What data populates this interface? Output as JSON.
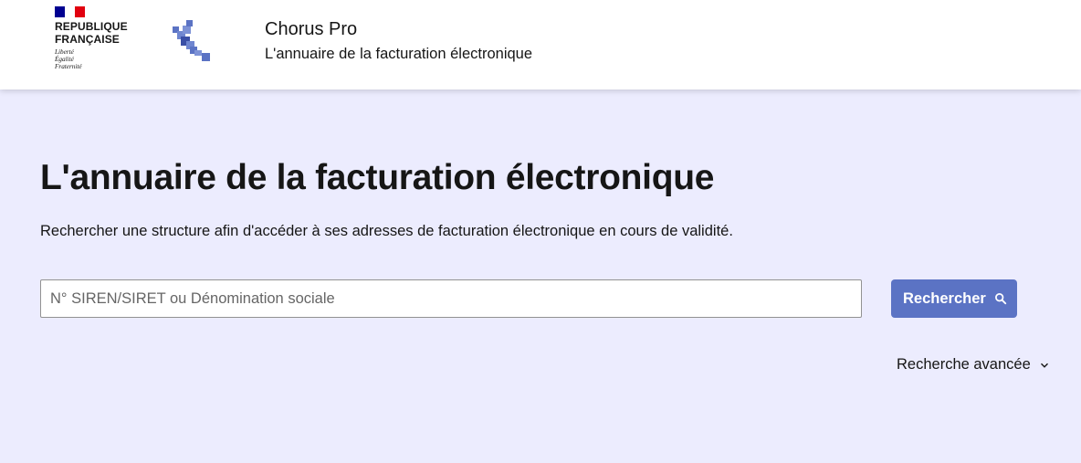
{
  "header": {
    "gov_block": {
      "name": "REPUBLIQUE\nFRANÇAISE",
      "motto": "Liberté\nÉgalité\nFraternité",
      "flag_colors": [
        "#000091",
        "#ffffff",
        "#e1000f"
      ]
    },
    "logo_icon": "chorus-pro-logo-icon",
    "site_title": "Chorus Pro",
    "site_tagline": "L'annuaire de la facturation électronique"
  },
  "main": {
    "title": "L'annuaire de la facturation électronique",
    "lead": "Rechercher une structure afin d'accéder à ses adresses de facturation électronique en cours de validité.",
    "search": {
      "placeholder": "N° SIREN/SIRET ou Dénomination sociale",
      "value": "",
      "button_label": "Rechercher",
      "button_icon": "search-icon"
    },
    "advanced_search": {
      "label": "Recherche avancée",
      "icon": "chevron-down-icon"
    }
  },
  "colors": {
    "hero_background": "#ececfe",
    "button_background": "#5b73c4",
    "logo_primary": "#5b73c4",
    "logo_dark": "#000091"
  }
}
